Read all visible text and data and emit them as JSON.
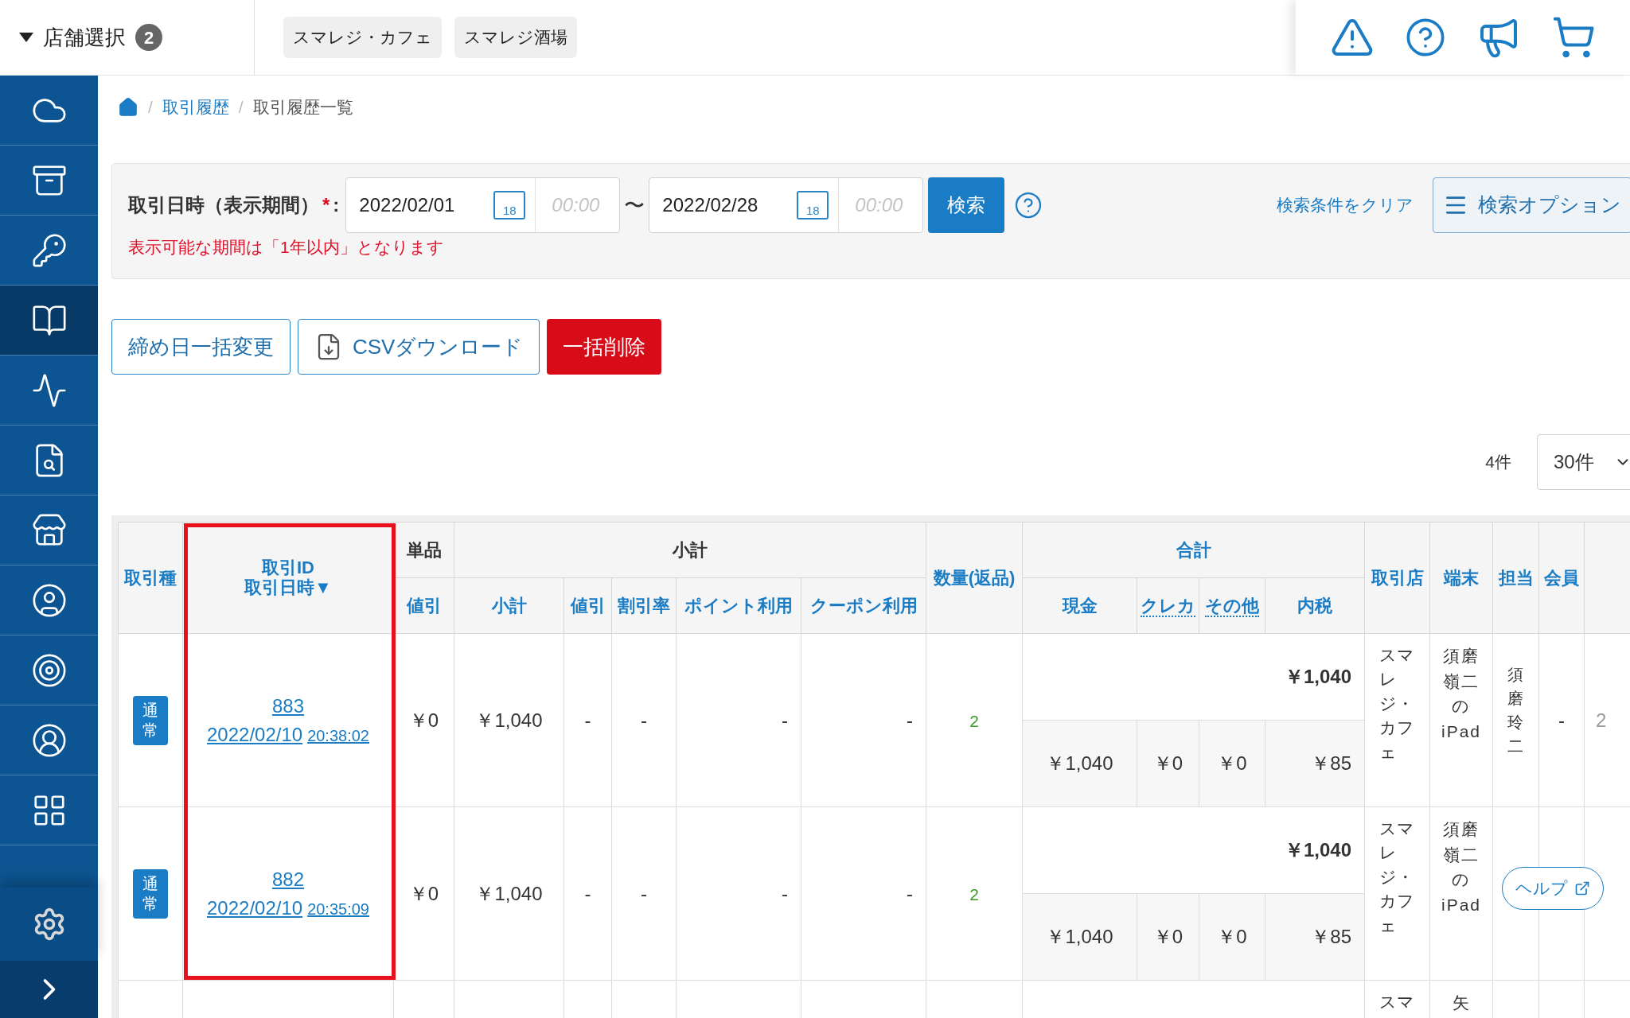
{
  "top_bar": {
    "store_selector": {
      "label": "店舗選択",
      "count": "2"
    },
    "stores": [
      {
        "name": "スマレジ・カフェ"
      },
      {
        "name": "スマレジ酒場"
      }
    ]
  },
  "sidebar": {
    "items": [
      {
        "selected": false
      },
      {
        "selected": false
      },
      {
        "selected": false
      },
      {
        "selected": true
      },
      {
        "selected": false
      },
      {
        "selected": false
      },
      {
        "selected": false
      },
      {
        "selected": false
      },
      {
        "selected": false
      },
      {
        "selected": false
      },
      {
        "selected": false
      }
    ]
  },
  "breadcrumb": {
    "separator": "/",
    "items": [
      "取引履歴",
      "取引履歴一覧"
    ]
  },
  "search": {
    "label": "取引日時（表示期間）",
    "required_mark": "*",
    "colon": ":",
    "from": {
      "date": "2022/02/01",
      "calendar_day": "18",
      "time_placeholder": "00:00"
    },
    "separator": "〜",
    "to": {
      "date": "2022/02/28",
      "calendar_day": "18",
      "time_placeholder": "00:00"
    },
    "search_button": "検索",
    "clear_link": "検索条件をクリア",
    "options_button": "検索オプション",
    "note": "表示可能な期間は「1年以内」となります"
  },
  "actions": [
    {
      "kind": "outline",
      "label": "締め日一括変更"
    },
    {
      "kind": "download",
      "label": "CSVダウンロード"
    },
    {
      "kind": "danger",
      "label": "一括削除"
    }
  ],
  "pagination": {
    "count": "4件",
    "per_page": "30件"
  },
  "table": {
    "columns": [
      {
        "label": "取引種",
        "sortable": true
      },
      {
        "label": "取引ID",
        "label_2": "取引日時▼",
        "sortable": true
      },
      {
        "label": "単品",
        "sortable": false,
        "children": [
          {
            "label": "値引",
            "sortable": true
          }
        ]
      },
      {
        "label": "小計",
        "sortable": false,
        "children": [
          {
            "label": "小計",
            "sortable": true
          },
          {
            "label": "値引",
            "sortable": true
          },
          {
            "label": "割引率",
            "sortable": true
          },
          {
            "label": "ポイント利用",
            "sortable": true
          },
          {
            "label": "クーポン利用",
            "sortable": true
          }
        ]
      },
      {
        "label": "数量(返品)",
        "sortable": true
      },
      {
        "label": "合計",
        "sortable": true,
        "children": [
          {
            "label": "現金",
            "sortable": true
          },
          {
            "label": "クレカ",
            "sortable": true,
            "tooltip": true
          },
          {
            "label": "その他",
            "sortable": true,
            "tooltip": true
          },
          {
            "label": "内税",
            "sortable": true
          }
        ]
      },
      {
        "label": "取引店",
        "sortable": true
      },
      {
        "label": "端末",
        "sortable": true
      },
      {
        "label": "担当",
        "sortable": true
      },
      {
        "label": "会員",
        "sortable": true
      }
    ],
    "rows": [
      {
        "type": "通常",
        "id": "883",
        "date": "2022/02/10",
        "time": "20:38:02",
        "cells": [
          "￥0",
          "￥1,040",
          "-",
          "-",
          "-",
          "-"
        ],
        "quantity": "2",
        "total": "￥1,040",
        "breakdown": [
          "￥1,040",
          "￥0",
          "￥0",
          "￥85"
        ],
        "store": "スマレジ・カフェ",
        "terminal": "須磨嶺二のiPad",
        "staff": "須磨玲二",
        "member": "-",
        "column_19": "2"
      },
      {
        "type": "通常",
        "id": "882",
        "date": "2022/02/10",
        "time": "20:35:09",
        "cells": [
          "￥0",
          "￥1,040",
          "-",
          "-",
          "-",
          "-"
        ],
        "quantity": "2",
        "total": "￥1,040",
        "breakdown": [
          "￥1,040",
          "￥0",
          "￥0",
          "￥85"
        ],
        "store": "スマレジ・カフェ",
        "terminal": "須磨嶺二のiPad"
      },
      {
        "store": "スマ",
        "terminal": "矢"
      }
    ]
  },
  "help_button": "ヘルプ"
}
